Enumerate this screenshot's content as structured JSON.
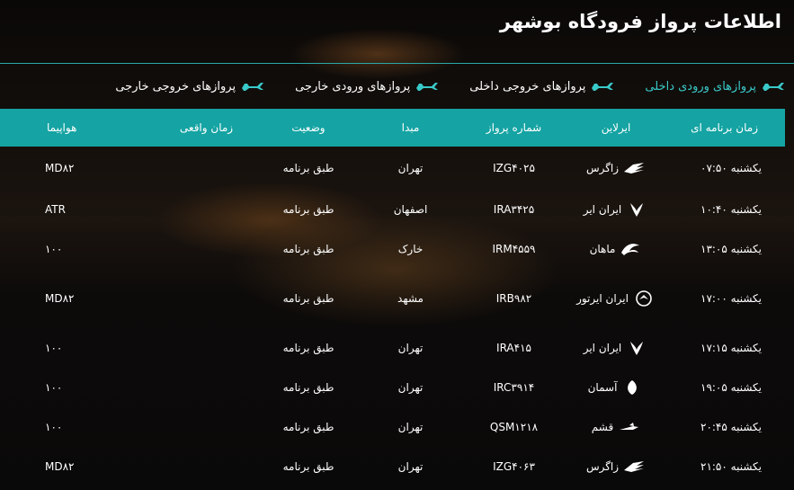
{
  "page": {
    "title": "اطلاعات پرواز فرودگاه بوشهر"
  },
  "tabs": [
    {
      "label": "پروازهای ورودی داخلی",
      "active": true
    },
    {
      "label": "پروازهای خروجی داخلی",
      "active": false
    },
    {
      "label": "پروازهای ورودی خارجی",
      "active": false
    },
    {
      "label": "پروازهای خروجی خارجی",
      "active": false
    }
  ],
  "table": {
    "headers": {
      "scheduled": "زمان برنامه ای",
      "airline": "ایرلاین",
      "flight": "شماره پرواز",
      "origin": "مبدا",
      "status": "وضعیت",
      "actual": "زمان واقعی",
      "aircraft": "هواپیما"
    },
    "rows": [
      {
        "scheduled": "یکشنبه ۰۷:۵۰",
        "airline": "زاگرس",
        "logo": "zagros-logo-icon",
        "flight": "IZG۴۰۲۵",
        "origin": "تهران",
        "status": "طبق برنامه",
        "actual": "",
        "aircraft": "MD۸۲"
      },
      {
        "scheduled": "یکشنبه ۱۰:۴۰",
        "airline": "ایران ایر",
        "logo": "iranair-logo-icon",
        "flight": "IRA۳۴۲۵",
        "origin": "اصفهان",
        "status": "طبق برنامه",
        "actual": "",
        "aircraft": "ATR"
      },
      {
        "scheduled": "یکشنبه ۱۳:۰۵",
        "airline": "ماهان",
        "logo": "mahan-logo-icon",
        "flight": "IRM۴۵۵۹",
        "origin": "خارک",
        "status": "طبق برنامه",
        "actual": "",
        "aircraft": "۱۰۰"
      },
      {
        "scheduled": "یکشنبه ۱۷:۰۰",
        "airline": "ایران ایرتور",
        "logo": "iranairtour-logo-icon",
        "flight": "IRB۹۸۲",
        "origin": "مشهد",
        "status": "طبق برنامه",
        "actual": "",
        "aircraft": "MD۸۲"
      },
      {
        "scheduled": "یکشنبه ۱۷:۱۵",
        "airline": "ایران ایر",
        "logo": "iranair-logo-icon",
        "flight": "IRA۴۱۵",
        "origin": "تهران",
        "status": "طبق برنامه",
        "actual": "",
        "aircraft": "۱۰۰"
      },
      {
        "scheduled": "یکشنبه ۱۹:۰۵",
        "airline": "آسمان",
        "logo": "aseman-logo-icon",
        "flight": "IRC۳۹۱۴",
        "origin": "تهران",
        "status": "طبق برنامه",
        "actual": "",
        "aircraft": "۱۰۰"
      },
      {
        "scheduled": "یکشنبه ۲۰:۴۵",
        "airline": "قشم",
        "logo": "qeshm-logo-icon",
        "flight": "QSM۱۲۱۸",
        "origin": "تهران",
        "status": "طبق برنامه",
        "actual": "",
        "aircraft": "۱۰۰"
      },
      {
        "scheduled": "یکشنبه ۲۱:۵۰",
        "airline": "زاگرس",
        "logo": "zagros-logo-icon",
        "flight": "IZG۴۰۶۳",
        "origin": "تهران",
        "status": "طبق برنامه",
        "actual": "",
        "aircraft": "MD۸۲"
      }
    ]
  },
  "colors": {
    "accent": "#15a3a3",
    "active_tab": "#39c9c9",
    "header_line": "#2aa8a8"
  }
}
